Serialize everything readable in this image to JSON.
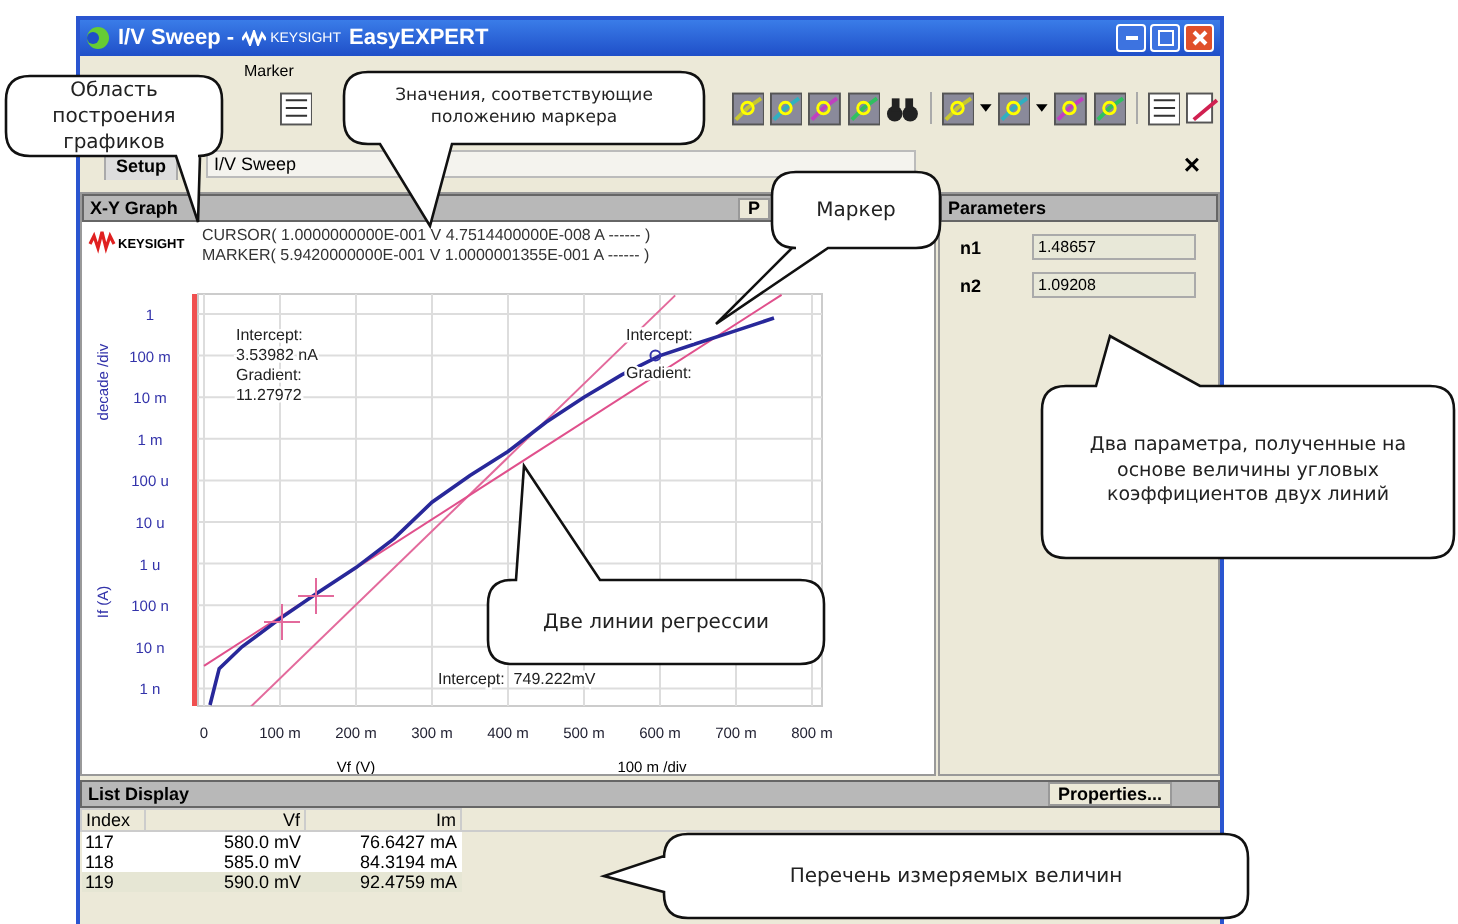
{
  "window": {
    "title": "I/V Sweep -",
    "brand": "KEYSIGHT",
    "app": "EasyEXPERT"
  },
  "menu": [
    "Marker"
  ],
  "setup": {
    "tab": "Setup",
    "field": "I/V Sweep",
    "close": "×"
  },
  "graph": {
    "title": "X-Y Graph",
    "partial_button": "P",
    "brand": "KEYSIGHT",
    "cursor": "CURSOR( 1.0000000000E-001 V 4.7514400000E-008 A ------ )",
    "marker": "MARKER( 5.9420000000E-001 V 1.0000001355E-001 A ------ )",
    "y_label": "If (A)",
    "y_scale_label": "decade /div",
    "x_label": "Vf (V)",
    "x_scale_label": "100 m /div",
    "y_ticks": [
      "1",
      "100 m",
      "10 m",
      "1 m",
      "100 u",
      "10 u",
      "1 u",
      "100 n",
      "10 n",
      "1 n"
    ],
    "x_ticks": [
      "0",
      "100 m",
      "200 m",
      "300 m",
      "400 m",
      "500 m",
      "600 m",
      "700 m",
      "800 m"
    ],
    "annotations": [
      "Intercept:",
      "3.53982 nA",
      "Gradient:",
      "11.27972",
      "Intercept:",
      "Gradient:",
      "Intercept:  749.222mV"
    ]
  },
  "parameters": {
    "title": "Parameters",
    "items": [
      {
        "name": "n1",
        "value": "1.48657"
      },
      {
        "name": "n2",
        "value": "1.09208"
      }
    ]
  },
  "list_display": {
    "title": "List Display",
    "button": "Properties...",
    "columns": [
      "Index",
      "Vf",
      "Im"
    ],
    "rows": [
      {
        "cells": [
          "117",
          "580.0 mV",
          "76.6427 mA"
        ],
        "selected": false
      },
      {
        "cells": [
          "118",
          "585.0 mV",
          "84.3194 mA"
        ],
        "selected": false
      },
      {
        "cells": [
          "119",
          "590.0 mV",
          "92.4759 mA"
        ],
        "selected": true
      }
    ]
  },
  "callouts": [
    {
      "text": "Область построения графиков"
    },
    {
      "text": "Значения, соответствующие положению маркера"
    },
    {
      "text": "Маркер"
    },
    {
      "text": "Две линии регрессии"
    },
    {
      "text": "Два параметра, полученные на основе величины угловых коэффициентов двух линий"
    },
    {
      "text": "Перечень измеряемых величин"
    }
  ]
}
